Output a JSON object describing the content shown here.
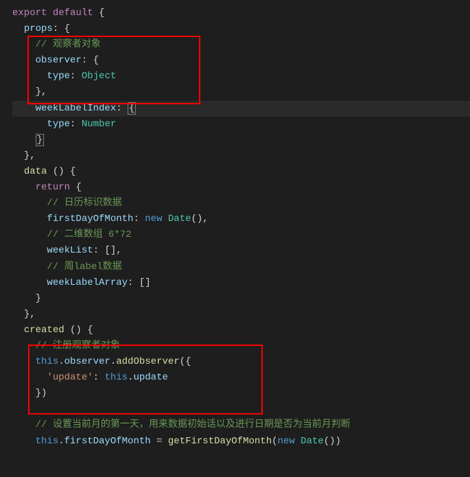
{
  "code": {
    "l1_export": "export",
    "l1_default": "default",
    "l1_brace": " {",
    "l2_props": "props",
    "l2_rest": ": {",
    "l3_comment": "// 观察者对象",
    "l4_observer": "observer",
    "l4_rest": ": {",
    "l5_type": "type",
    "l5_colon": ": ",
    "l5_object": "Object",
    "l6_close": "},",
    "l7_weeklabel": "weekLabelIndex",
    "l7_rest": ": ",
    "l7_brace": "{",
    "l8_type": "type",
    "l8_colon": ": ",
    "l8_number": "Number",
    "l9_close": "}",
    "l10_close": "},",
    "l11_data": "data",
    "l11_parens": " () {",
    "l12_return": "return",
    "l12_brace": " {",
    "l13_comment": "// 日历标识数据",
    "l14_firstday": "firstDayOfMonth",
    "l14_colon": ": ",
    "l14_new": "new",
    "l14_date": " Date",
    "l14_end": "(),",
    "l15_comment": "// 二维数组 6*72",
    "l16_weeklist": "weekList",
    "l16_rest": ": [],",
    "l17_comment": "// 周label数据",
    "l18_weeklabelarray": "weekLabelArray",
    "l18_rest": ": []",
    "l19_close": "}",
    "l20_close": "},",
    "l21_created": "created",
    "l21_parens": " () {",
    "l22_comment": "// 注册观察者对象",
    "l23_this": "this",
    "l23_dot1": ".",
    "l23_observer": "observer",
    "l23_dot2": ".",
    "l23_addobs": "addObserver",
    "l23_open": "({",
    "l24_update": "'update'",
    "l24_colon": ": ",
    "l24_this": "this",
    "l24_dot": ".",
    "l24_updatemethod": "update",
    "l25_close": "})",
    "l26_empty": "",
    "l27_comment": "// 设置当前月的第一天，用来数据初始话以及进行日期是否为当前月判断",
    "l28_this": "this",
    "l28_dot": ".",
    "l28_firstday": "firstDayOfMonth",
    "l28_eq": " = ",
    "l28_getfirst": "getFirstDayOfMonth",
    "l28_open": "(",
    "l28_new": "new",
    "l28_date": " Date",
    "l28_end": "())"
  }
}
